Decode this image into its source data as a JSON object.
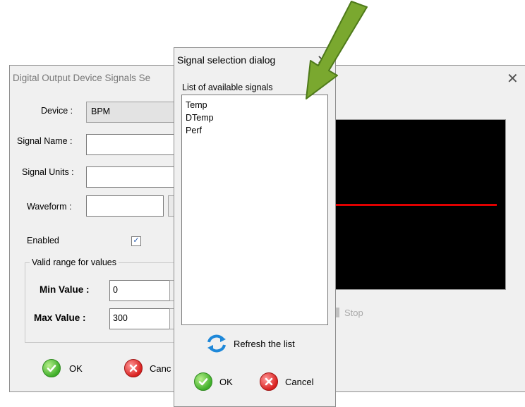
{
  "main_dialog": {
    "title": "Digital Output Device Signals Se",
    "close_glyph": "✕",
    "device_label": "Device :",
    "device_value": "BPM",
    "signal_name_label": "Signal Name :",
    "signal_name_value": "",
    "signal_units_label": "Signal Units :",
    "signal_units_value": "",
    "waveform_label": "Waveform :",
    "waveform_value": "",
    "enabled_label": "Enabled",
    "enabled_checked": true,
    "valid_range_title": "Valid range for values",
    "min_label": "Min Value :",
    "min_value": "0",
    "max_label": "Max Value :",
    "max_value": "300",
    "stop_label": "Stop",
    "ok_label": "OK",
    "cancel_label": "Canc",
    "plot_line_color": "#e00000"
  },
  "signal_dialog": {
    "title": "Signal selection dialog",
    "close_glyph": "✕",
    "list_label": "List of available signals",
    "signals": [
      "Temp",
      "DTemp",
      "Perf"
    ],
    "refresh_label": "Refresh the list",
    "ok_label": "OK",
    "cancel_label": "Cancel"
  },
  "icons": {
    "ok": "check-circle-icon",
    "cancel": "x-circle-icon",
    "refresh": "refresh-arrows-icon",
    "annotation": "green-arrow-icon"
  },
  "colors": {
    "ok_green": "#3fae2a",
    "cancel_red": "#d9201f",
    "arrow_green": "#7aa82f"
  }
}
